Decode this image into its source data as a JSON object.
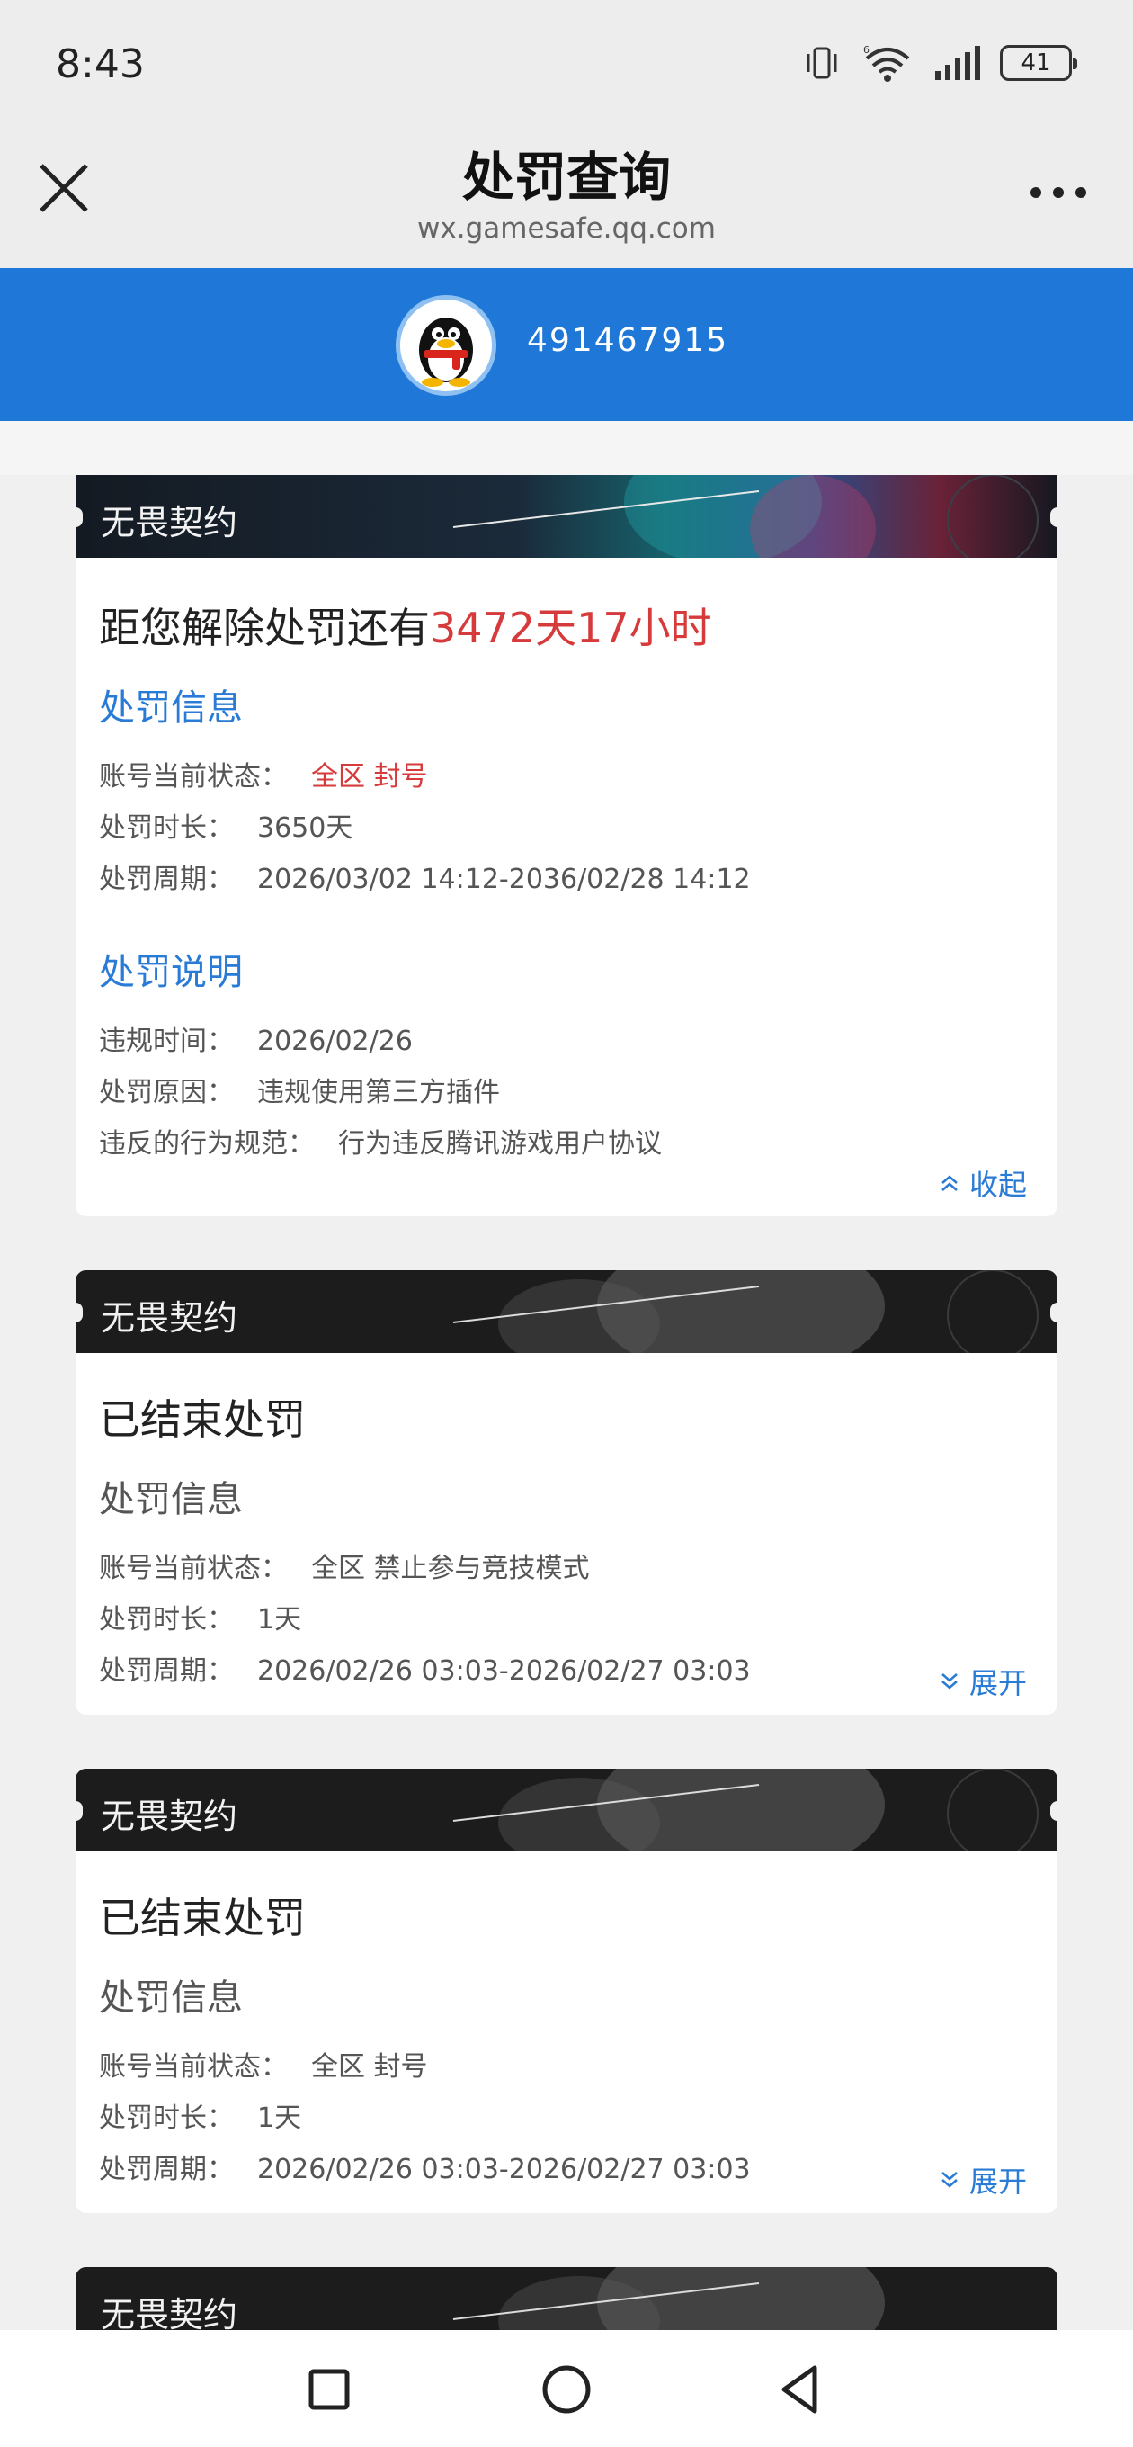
{
  "status_bar": {
    "time": "8:43",
    "battery": "41"
  },
  "title_bar": {
    "title": "处罚查询",
    "url": "wx.gamesafe.qq.com"
  },
  "user": {
    "qq_number": "491467915"
  },
  "cards": [
    {
      "banner_title": "无畏契约",
      "headline_prefix": "距您解除处罚还有",
      "headline_highlight": "3472天17小时",
      "info_title": "处罚信息",
      "status_label": "账号当前状态：",
      "status_value": "全区 封号",
      "duration_label": "处罚时长：",
      "duration_value": "3650天",
      "period_label": "处罚周期：",
      "period_value": "2026/03/02 14:12-2036/02/28 14:12",
      "explain_title": "处罚说明",
      "violation_time_label": "违规时间：",
      "violation_time_value": "2026/02/26",
      "reason_label": "处罚原因：",
      "reason_value": "违规使用第三方插件",
      "rule_label": "违反的行为规范：",
      "rule_value": "行为违反腾讯游戏用户协议",
      "toggle_label": "收起"
    },
    {
      "banner_title": "无畏契约",
      "headline": "已结束处罚",
      "info_title": "处罚信息",
      "status_label": "账号当前状态：",
      "status_value": "全区 禁止参与竞技模式",
      "duration_label": "处罚时长：",
      "duration_value": "1天",
      "period_label": "处罚周期：",
      "period_value": "2026/02/26 03:03-2026/02/27 03:03",
      "toggle_label": "展开"
    },
    {
      "banner_title": "无畏契约",
      "headline": "已结束处罚",
      "info_title": "处罚信息",
      "status_label": "账号当前状态：",
      "status_value": "全区 封号",
      "duration_label": "处罚时长：",
      "duration_value": "1天",
      "period_label": "处罚周期：",
      "period_value": "2026/02/26 03:03-2026/02/27 03:03",
      "toggle_label": "展开"
    },
    {
      "banner_title": "无畏契约"
    }
  ],
  "colors": {
    "accent_blue": "#1f78d8",
    "link_blue": "#2a7bd5",
    "alert_red": "#d63a3a"
  },
  "icons": [
    "vibrate-icon",
    "wifi-icon",
    "signal-icon",
    "battery-icon",
    "close-icon",
    "more-icon",
    "qq-penguin-icon",
    "chevron-up-icon",
    "chevron-down-icon",
    "square-nav-icon",
    "circle-nav-icon",
    "back-triangle-icon"
  ]
}
